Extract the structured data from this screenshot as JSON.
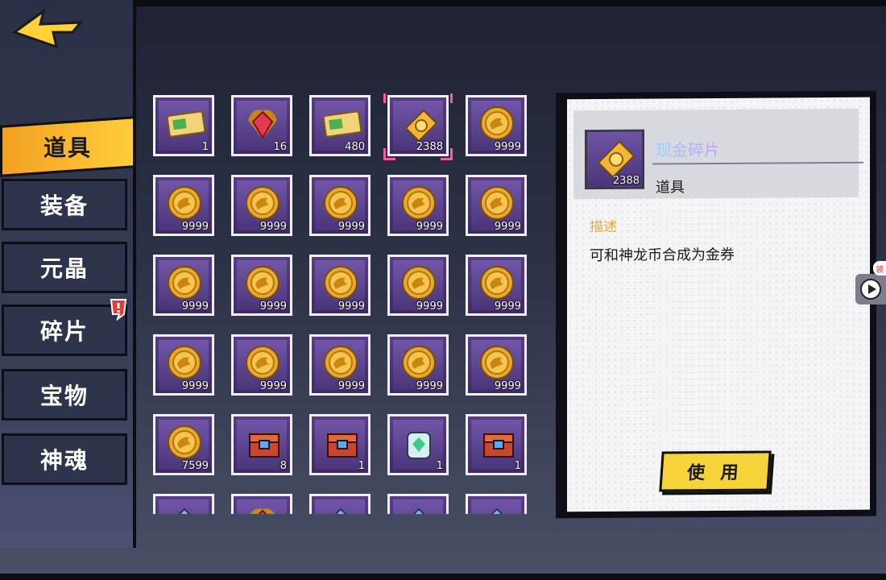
{
  "nav": {
    "back_icon": "back-arrow-icon",
    "tabs": [
      {
        "label": "道具",
        "active": true
      },
      {
        "label": "装备",
        "active": false
      },
      {
        "label": "元晶",
        "active": false
      },
      {
        "label": "碎片",
        "active": false,
        "alert": true
      },
      {
        "label": "宝物",
        "active": false
      },
      {
        "label": "神魂",
        "active": false
      }
    ]
  },
  "inventory": {
    "items": [
      {
        "icon": "cash-ticket-icon",
        "count": "1"
      },
      {
        "icon": "red-gem-icon",
        "count": "16"
      },
      {
        "icon": "cash-voucher-icon",
        "count": "480"
      },
      {
        "icon": "gold-ticket-fragment-icon",
        "count": "2388",
        "selected": true
      },
      {
        "icon": "dragon-coin-icon",
        "count": "9999"
      },
      {
        "icon": "dragon-coin-icon",
        "count": "9999"
      },
      {
        "icon": "dragon-coin-icon",
        "count": "9999"
      },
      {
        "icon": "dragon-coin-icon",
        "count": "9999"
      },
      {
        "icon": "dragon-coin-icon",
        "count": "9999"
      },
      {
        "icon": "dragon-coin-icon",
        "count": "9999"
      },
      {
        "icon": "dragon-coin-icon",
        "count": "9999"
      },
      {
        "icon": "dragon-coin-icon",
        "count": "9999"
      },
      {
        "icon": "dragon-coin-icon",
        "count": "9999"
      },
      {
        "icon": "dragon-coin-icon",
        "count": "9999"
      },
      {
        "icon": "dragon-coin-icon",
        "count": "9999"
      },
      {
        "icon": "dragon-coin-icon",
        "count": "9999"
      },
      {
        "icon": "dragon-coin-icon",
        "count": "9999"
      },
      {
        "icon": "dragon-coin-icon",
        "count": "9999"
      },
      {
        "icon": "dragon-coin-icon",
        "count": "9999"
      },
      {
        "icon": "dragon-coin-icon",
        "count": "9999"
      },
      {
        "icon": "dragon-coin-icon",
        "count": "7599"
      },
      {
        "icon": "ssr-chest-icon",
        "count": "8"
      },
      {
        "icon": "gem-chest-icon",
        "count": "1"
      },
      {
        "icon": "crystal-jar-icon",
        "count": "1"
      },
      {
        "icon": "colorful-chest-icon",
        "count": "1"
      },
      {
        "icon": "blue-item-icon",
        "count": ""
      },
      {
        "icon": "red-crystal-icon",
        "count": ""
      },
      {
        "icon": "silver-item-icon",
        "count": ""
      },
      {
        "icon": "gold-pile-icon",
        "count": ""
      },
      {
        "icon": "green-gem-icon",
        "count": ""
      }
    ]
  },
  "detail": {
    "icon": "gold-ticket-fragment-icon",
    "count": "2388",
    "name": "现金碎片",
    "type": "道具",
    "desc_label": "描述",
    "desc_text": "可和神龙币合成为金券",
    "use_label": "使 用"
  },
  "side": {
    "badge": "领",
    "icon": "play-icon"
  },
  "colors": {
    "accent": "#ffc93c",
    "panel": "#2e344b",
    "slot": "#4a3578",
    "use_button": "#f7d33a"
  }
}
